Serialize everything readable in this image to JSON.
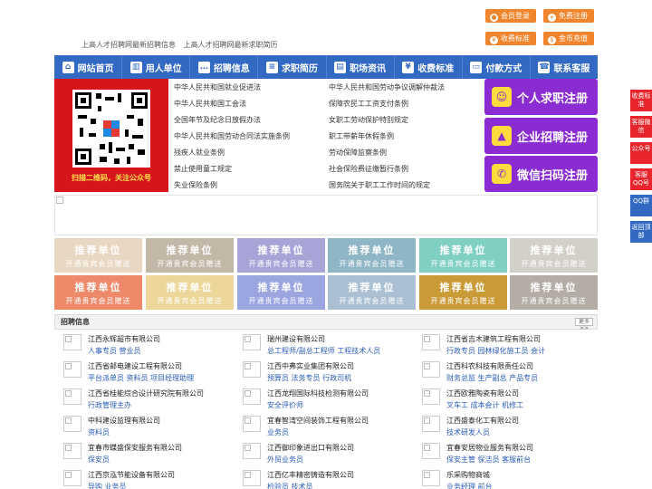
{
  "header": {
    "links": [
      "上高人才招聘网最新招聘信息",
      "上高人才招聘网最新求职简历"
    ],
    "buttons": [
      {
        "label": "会员登录",
        "icon": "user-icon"
      },
      {
        "label": "免费注册",
        "icon": "register-icon"
      },
      {
        "label": "收费标准",
        "icon": "yen-icon"
      },
      {
        "label": "金币充值",
        "icon": "coin-icon"
      }
    ]
  },
  "nav": {
    "items": [
      {
        "label": "网站首页",
        "icon": "home-icon"
      },
      {
        "label": "用人单位",
        "icon": "building-icon"
      },
      {
        "label": "招聘信息",
        "icon": "chat-icon"
      },
      {
        "label": "求职简历",
        "icon": "resume-icon"
      },
      {
        "label": "职场资讯",
        "icon": "news-icon"
      },
      {
        "label": "收费标准",
        "icon": "fee-icon"
      },
      {
        "label": "付款方式",
        "icon": "wallet-icon"
      },
      {
        "label": "联系客服",
        "icon": "phone-icon"
      }
    ]
  },
  "qr": {
    "caption": "扫描二维码，关注公众号"
  },
  "laws": {
    "left": [
      "中华人民共和国就业促进法",
      "中华人民共和国工会法",
      "全国年节及纪念日放假办法",
      "中华人民共和国劳动合同法实施条例",
      "残疾人就业条例",
      "禁止使用童工规定",
      "失业保险条例"
    ],
    "right": [
      "中华人民共和国劳动争议调解仲裁法",
      "保障农民工工资支付条例",
      "女职工劳动保护特别规定",
      "职工带薪年休假条例",
      "劳动保障监察条例",
      "社会保险费征缴暂行条例",
      "国务院关于职工工作时间的规定"
    ]
  },
  "register": [
    {
      "label": "个人求职注册",
      "icon": "person-icon"
    },
    {
      "label": "企业招聘注册",
      "icon": "company-icon"
    },
    {
      "label": "微信扫码注册",
      "icon": "wechat-icon"
    }
  ],
  "tiles": {
    "title": "推荐单位",
    "subtitle": "开通贵宾会员赠送",
    "colors": [
      "#e8d7c3",
      "#c3b7a7",
      "#a9a4d8",
      "#8fb6c6",
      "#7fcfc3",
      "#d3d0ca",
      "#ee8a6a",
      "#ecd69a",
      "#9ba5e0",
      "#aac0d2",
      "#c99a36",
      "#b3ada6"
    ]
  },
  "jobs": {
    "heading": "招聘信息",
    "more": "更多>>",
    "columns": [
      [
        {
          "company": "江西永辉超市有限公司",
          "positions": "人事专员 营业员"
        },
        {
          "company": "江西省邮电建设工程有限公司",
          "positions": "平台派单员 资料员 项目经理助理"
        },
        {
          "company": "江西省桂能综合设计研究院有限公司",
          "positions": "行政管理主办"
        },
        {
          "company": "中科建设监理有限公司",
          "positions": "资料员"
        },
        {
          "company": "宜春市蝶盛保安服务有限公司",
          "positions": "保安员"
        },
        {
          "company": "江西京泓节能设备有限公司",
          "positions": "导购 业务员"
        }
      ],
      [
        {
          "company": "瑞州建设有限公司",
          "positions": "总工程师/副总工程师 工程技术人员"
        },
        {
          "company": "江西中弗实业集团有限公司",
          "positions": "预算员 法务专员 行政司机"
        },
        {
          "company": "江西龙翔国际科技检测有限公司",
          "positions": "安全评价师"
        },
        {
          "company": "宜春智湾空间装饰工程有限公司",
          "positions": "业务员"
        },
        {
          "company": "江西御印象进出口有限公司",
          "positions": "外贸业务员"
        },
        {
          "company": "江西亿丰精密铸造有限公司",
          "positions": "检验员 技术员"
        }
      ],
      [
        {
          "company": "江西省吉木建筑工程有限公司",
          "positions": "行政专员 园林绿化施工员 会计"
        },
        {
          "company": "江西科农科技有限责任公司",
          "positions": "财务总监 生产副总 产品专员"
        },
        {
          "company": "江西欧雅陶瓷有限公司",
          "positions": "叉车工 成本会计 机修工"
        },
        {
          "company": "江西盛泰化工有限公司",
          "positions": "技术研发人员"
        },
        {
          "company": "宜春安居物业服务有限公司",
          "positions": "保安主管 保洁员 客服前台"
        },
        {
          "company": "乐采购物商城",
          "positions": "业务经理 前台"
        }
      ]
    ]
  },
  "float_bar": [
    {
      "label": "收费标准",
      "color": "#e8242c"
    },
    {
      "label": "客服微信",
      "color": "#e8242c"
    },
    {
      "label": "公众号",
      "color": "#e8242c"
    },
    {
      "label": "客服QQ号",
      "color": "#e8242c"
    },
    {
      "label": "QQ群",
      "color": "#3269c2"
    },
    {
      "label": "返回顶部",
      "color": "#3269c2"
    }
  ]
}
